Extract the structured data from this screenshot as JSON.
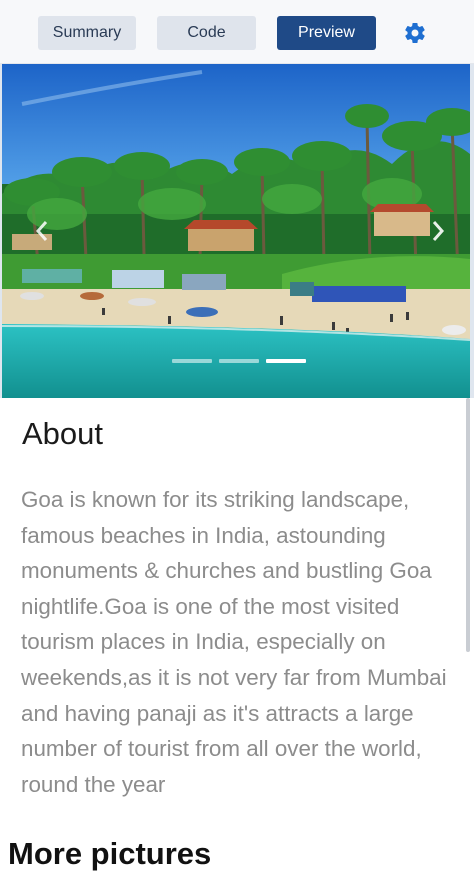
{
  "toolbar": {
    "tabs": [
      {
        "label": "Summary",
        "active": false
      },
      {
        "label": "Code",
        "active": false
      },
      {
        "label": "Preview",
        "active": true
      }
    ],
    "settings_icon": "gear-icon",
    "accent_color": "#1f4a87"
  },
  "carousel": {
    "slide_count": 3,
    "active_slide": 3,
    "prev_icon": "chevron-left-icon",
    "next_icon": "chevron-right-icon"
  },
  "about": {
    "title": "About",
    "text": "Goa is known for its striking landscape, famous beaches in India, astounding monuments & churches and bustling Goa nightlife.Goa is one of the most visited tourism places in India, especially on weekends,as it is not very far from Mumbai and having panaji as it's attracts a large number of tourist from all over the world, round the year"
  },
  "more_pictures": {
    "title": "More pictures"
  }
}
